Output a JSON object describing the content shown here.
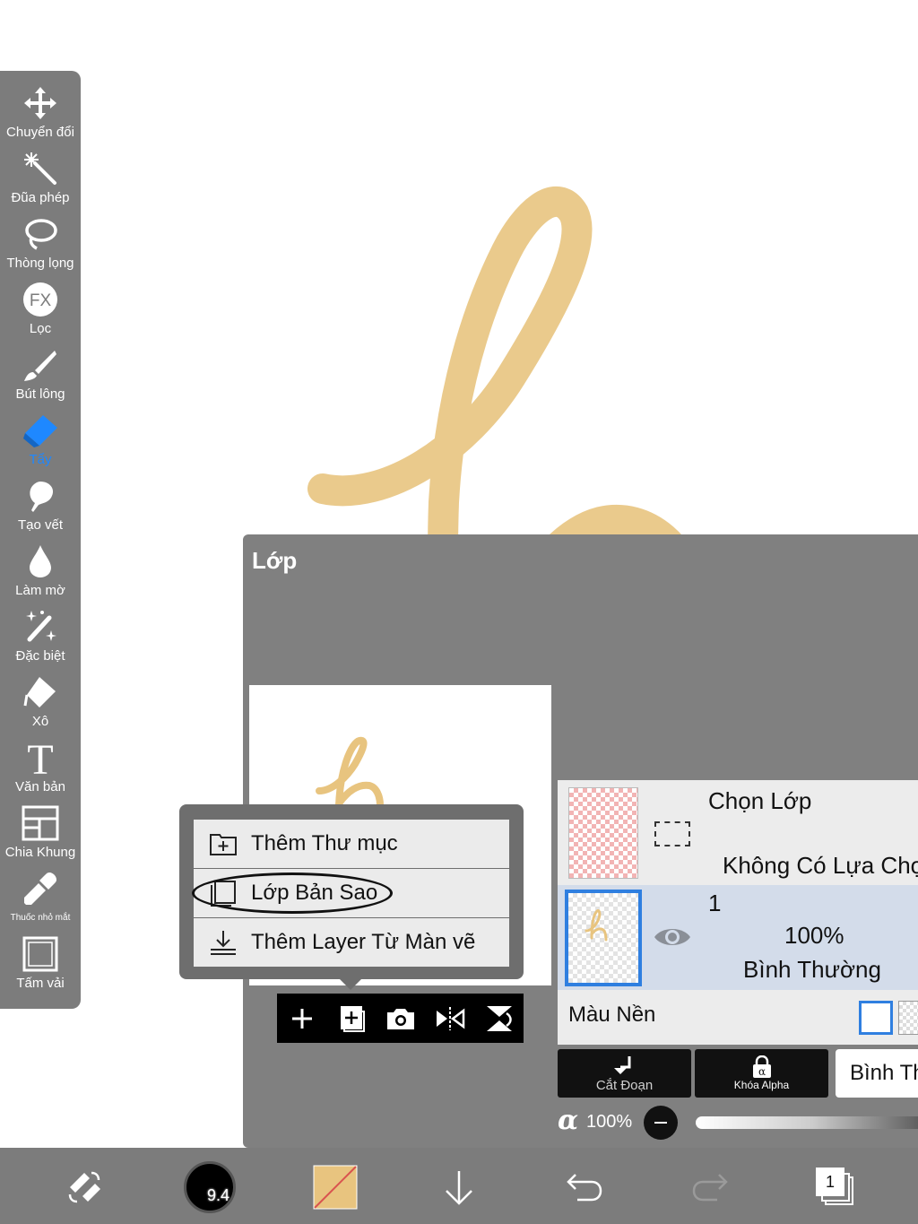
{
  "toolbar": {
    "tools": [
      {
        "label": "Chuyển đổi",
        "icon": "move-icon"
      },
      {
        "label": "Đũa phép",
        "icon": "magic-wand-icon"
      },
      {
        "label": "Thòng lọng",
        "icon": "lasso-icon"
      },
      {
        "label": "Lọc",
        "icon": "fx-filter-icon"
      },
      {
        "label": "Bút lông",
        "icon": "brush-icon"
      },
      {
        "label": "Tẩy",
        "icon": "eraser-icon"
      },
      {
        "label": "Tạo vết",
        "icon": "smudge-icon"
      },
      {
        "label": "Làm mờ",
        "icon": "blur-drop-icon"
      },
      {
        "label": "Đặc biệt",
        "icon": "special-brush-icon"
      },
      {
        "label": "Xô",
        "icon": "bucket-icon"
      },
      {
        "label": "Văn bản",
        "icon": "text-icon"
      },
      {
        "label": "Chia Khung",
        "icon": "frame-divider-icon"
      },
      {
        "label": "Thuốc nhỏ mắt",
        "icon": "eyedropper-icon"
      },
      {
        "label": "Tấm vải",
        "icon": "canvas-icon"
      }
    ],
    "active_index": 5,
    "active_color": "#1e88ff"
  },
  "layer_panel": {
    "title": "Lớp",
    "menu": [
      {
        "label": "Thêm Thư mục",
        "icon": "add-folder-icon"
      },
      {
        "label": "Lớp Bản Sao",
        "icon": "duplicate-layer-icon"
      },
      {
        "label": "Thêm Layer Từ Màn vẽ",
        "icon": "import-from-canvas-icon"
      }
    ],
    "actions": [
      "add-layer-icon",
      "add-copy-icon",
      "camera-icon",
      "flip-icon",
      "merge-down-icon"
    ],
    "selection": {
      "title": "Chọn Lớp",
      "value": "Không Có Lựa Chọn"
    },
    "layer1": {
      "name": "1",
      "opacity": "100%",
      "blend": "Bình Thường"
    },
    "background": {
      "label": "Màu Nền"
    },
    "clipping_label": "Cắt Đoạn",
    "alpha_lock_label": "Khóa Alpha",
    "blend_mode": "Bình Thường",
    "alpha_symbol": "α",
    "alpha_value": "100%"
  },
  "bottom_bar": {
    "brush_size": "9.4",
    "layer_count": "1"
  },
  "colors": {
    "stroke": "#e8c47f",
    "panel": "#808080",
    "toolbar": "#7c7c7c",
    "selected_layer": "#d3dcea"
  }
}
